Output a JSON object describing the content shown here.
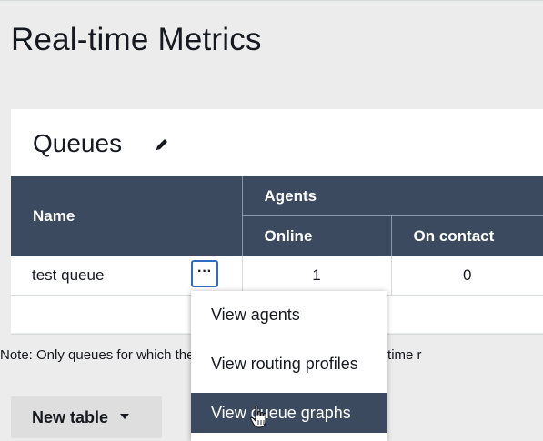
{
  "page": {
    "title": "Real-time Metrics"
  },
  "panel": {
    "title": "Queues",
    "edit_icon": "pencil-icon"
  },
  "table": {
    "group_header": "Agents",
    "columns": [
      "Name",
      "Online",
      "On contact"
    ],
    "rows": [
      {
        "name": "test queue",
        "online": "1",
        "on_contact": "0",
        "more_label": "···"
      }
    ]
  },
  "note": "Note: Only queues for which there was activity during the report time r",
  "buttons": {
    "new_table_label": "New table"
  },
  "dropdown": {
    "items": [
      {
        "label": "View agents",
        "state": "normal"
      },
      {
        "label": "View routing profiles",
        "state": "normal"
      },
      {
        "label": "View queue graphs",
        "state": "hovered"
      }
    ]
  },
  "colors": {
    "header_bg": "#3b4a5e",
    "focus_border": "#2e6dc5",
    "page_bg": "#ececec"
  },
  "icons": [
    "pencil-icon",
    "caret-down-icon",
    "hand-cursor-icon"
  ]
}
